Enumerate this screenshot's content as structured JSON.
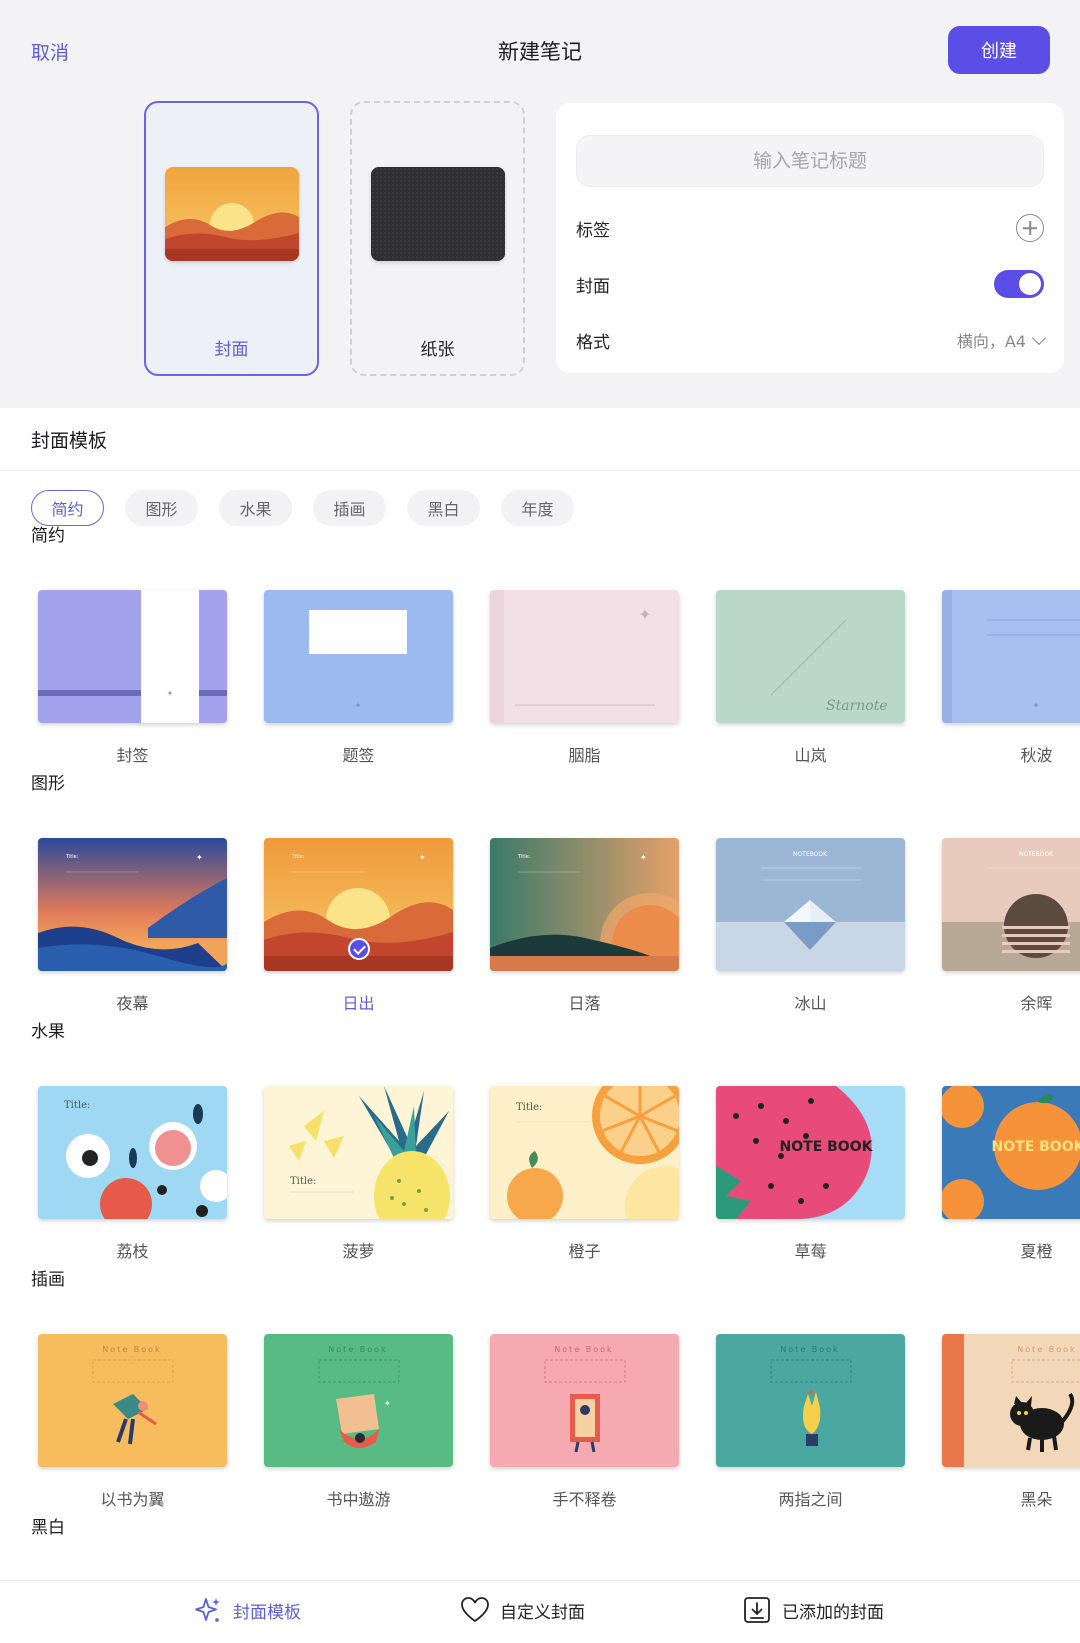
{
  "header": {
    "cancel": "取消",
    "title": "新建笔记",
    "create": "创建"
  },
  "options": {
    "cover": "封面",
    "paper": "纸张"
  },
  "panel": {
    "title_placeholder": "输入笔记标题",
    "tags_label": "标签",
    "cover_label": "封面",
    "cover_enabled": true,
    "format_label": "格式",
    "format_value": "横向，A4"
  },
  "templates": {
    "section_title": "封面模板",
    "chips": [
      "简约",
      "图形",
      "水果",
      "插画",
      "黑白",
      "年度"
    ],
    "active_chip": "简约",
    "categories": [
      {
        "title": "简约",
        "items": [
          "封签",
          "题签",
          "胭脂",
          "山岚",
          "秋波"
        ]
      },
      {
        "title": "图形",
        "items": [
          "夜幕",
          "日出",
          "日落",
          "冰山",
          "余晖"
        ]
      },
      {
        "title": "水果",
        "items": [
          "荔枝",
          "菠萝",
          "橙子",
          "草莓",
          "夏橙"
        ]
      },
      {
        "title": "插画",
        "items": [
          "以书为翼",
          "书中遨游",
          "手不释卷",
          "两指之间",
          "黑朵"
        ]
      },
      {
        "title": "黑白",
        "items": []
      }
    ],
    "selected": "日出",
    "cover_texts": {
      "title": "Title:",
      "notebook": "NOTEBOOK",
      "note_book": "Note Book",
      "note_book_caps": "NOTE BOOK",
      "starnote": "Starnote"
    }
  },
  "tabbar": {
    "templates": "封面模板",
    "custom": "自定义封面",
    "added": "已添加的封面"
  },
  "colors": {
    "accent": "#5b4ee6",
    "accent_text": "#5b5fd6"
  }
}
